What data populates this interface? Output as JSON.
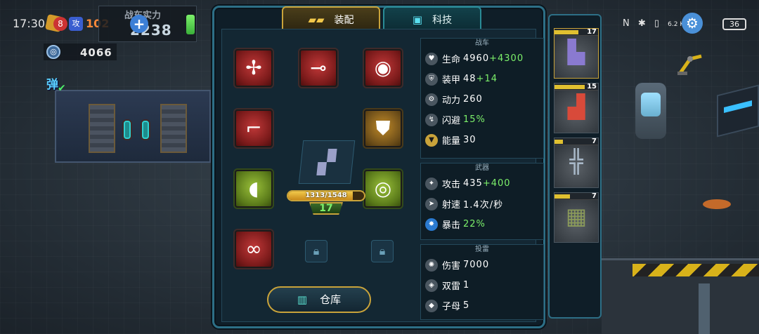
{
  "status_bar": {
    "time": "17:30",
    "net_speed": "6.2 K/s",
    "battery": "36"
  },
  "hud": {
    "level": "102",
    "rank_badge": "8",
    "shield_badge": "攻",
    "power_title": "战车实力",
    "power_value": "2238",
    "coins": "4066",
    "ammo_label": "弹"
  },
  "tabs": [
    {
      "label": "装配",
      "icon": "tank-icon",
      "active": true
    },
    {
      "label": "科技",
      "icon": "chip-icon",
      "active": false
    }
  ],
  "equipment_slots": [
    {
      "name": "propeller",
      "icon": "propeller-icon",
      "rarity": "red"
    },
    {
      "name": "cannon-barrel",
      "icon": "cannon-barrel-icon",
      "rarity": "red"
    },
    {
      "name": "gear-core",
      "icon": "gear-core-icon",
      "rarity": "red"
    },
    {
      "name": "laser-gun",
      "icon": "laser-gun-icon",
      "rarity": "red"
    },
    {
      "name": "armor-vest",
      "icon": "armor-vest-icon",
      "rarity": "gold"
    },
    {
      "name": "mortar",
      "icon": "mortar-icon",
      "rarity": "green"
    },
    {
      "name": "engine",
      "icon": "engine-icon",
      "rarity": "green"
    },
    {
      "name": "binoculars",
      "icon": "binoculars-icon",
      "rarity": "red"
    }
  ],
  "tank": {
    "xp_text": "1313/1548",
    "xp_current": 1313,
    "xp_max": 1548,
    "level": "17"
  },
  "warehouse_label": "仓库",
  "stat_groups": [
    {
      "title": "战车",
      "rows": [
        {
          "icon": "heart-icon",
          "label": "生命",
          "value": "4960",
          "bonus": "+4300"
        },
        {
          "icon": "armor-icon",
          "label": "装甲",
          "value": "48",
          "bonus": "+14"
        },
        {
          "icon": "gear-icon",
          "label": "动力",
          "value": "260",
          "bonus": ""
        },
        {
          "icon": "dodge-icon",
          "label": "闪避",
          "value": "15%",
          "bonus": "",
          "green": true
        },
        {
          "icon": "energy-icon",
          "label": "能量",
          "value": "30",
          "bonus": ""
        }
      ]
    },
    {
      "title": "武器",
      "rows": [
        {
          "icon": "attack-icon",
          "label": "攻击",
          "value": "435",
          "bonus": "+400"
        },
        {
          "icon": "speed-icon",
          "label": "射速",
          "value": "1.4次/秒",
          "bonus": ""
        },
        {
          "icon": "crit-icon",
          "label": "暴击",
          "value": "22%",
          "bonus": "",
          "green": true
        }
      ]
    },
    {
      "title": "投雷",
      "rows": [
        {
          "icon": "damage-icon",
          "label": "伤害",
          "value": "7000",
          "bonus": ""
        },
        {
          "icon": "double-mine-icon",
          "label": "双雷",
          "value": "1",
          "bonus": ""
        },
        {
          "icon": "cluster-mine-icon",
          "label": "子母",
          "value": "5",
          "bonus": ""
        }
      ]
    }
  ],
  "vehicles": [
    {
      "level": "17",
      "progress": 0.55,
      "art": "purple-tank-icon",
      "active": true
    },
    {
      "level": "15",
      "progress": 0.7,
      "art": "red-buggy-icon",
      "active": false
    },
    {
      "level": "7",
      "progress": 0.2,
      "art": "turret-mech-icon",
      "active": false
    },
    {
      "level": "7",
      "progress": 0.35,
      "art": "missile-walker-icon",
      "active": false
    }
  ],
  "background_text": {
    "star_count": "159"
  }
}
